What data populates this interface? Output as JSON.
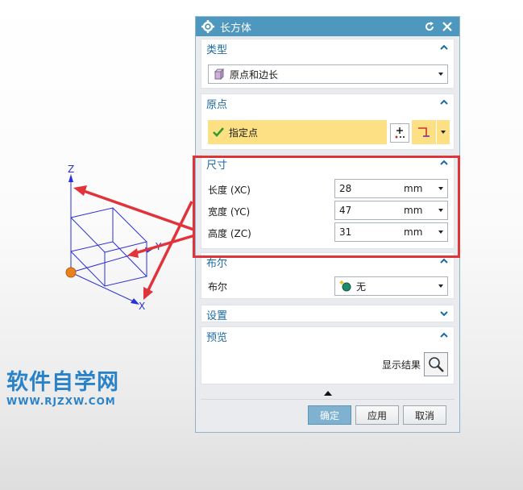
{
  "dialog": {
    "title": "长方体"
  },
  "type_section": {
    "header": "类型",
    "selected": "原点和边长"
  },
  "origin_section": {
    "header": "原点",
    "specify_point": "指定点"
  },
  "dimension_section": {
    "header": "尺寸",
    "fields": [
      {
        "label": "长度 (XC)",
        "value": "28",
        "unit": "mm"
      },
      {
        "label": "宽度 (YC)",
        "value": "47",
        "unit": "mm"
      },
      {
        "label": "高度 (ZC)",
        "value": "31",
        "unit": "mm"
      }
    ]
  },
  "boolean_section": {
    "header": "布尔",
    "label": "布尔",
    "selected": "无"
  },
  "settings_section": {
    "header": "设置"
  },
  "preview_section": {
    "header": "预览",
    "show_result": "显示结果"
  },
  "buttons": {
    "ok": "确定",
    "apply": "应用",
    "cancel": "取消"
  },
  "axes": {
    "x": "X",
    "y": "Y",
    "z": "Z"
  },
  "watermark": {
    "title": "软件自学网",
    "url": "WWW.RJZXW.COM"
  },
  "colors": {
    "accent": "#4e97be",
    "header_text": "#1c6aa0",
    "highlight": "#fde083",
    "annotation_red": "#e0333a",
    "axis_blue": "#2228d8"
  }
}
